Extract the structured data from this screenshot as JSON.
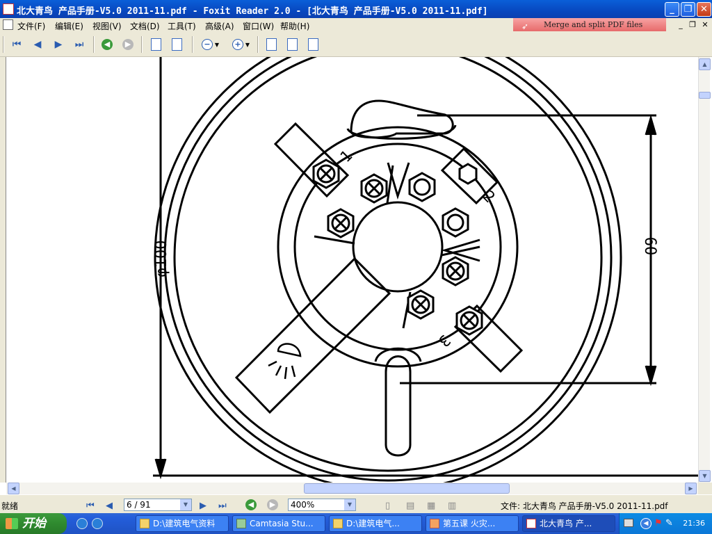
{
  "window": {
    "title": "北大青鸟 产品手册-V5.0 2011-11.pdf - Foxit Reader 2.0 - [北大青鸟 产品手册-V5.0 2011-11.pdf]"
  },
  "menu": {
    "items": [
      {
        "label": "文件(F)"
      },
      {
        "label": "编辑(E)"
      },
      {
        "label": "视图(V)"
      },
      {
        "label": "文档(D)"
      },
      {
        "label": "工具(T)"
      },
      {
        "label": "高级(A)"
      },
      {
        "label": "窗口(W)"
      },
      {
        "label": "帮助(H)"
      }
    ]
  },
  "ad_banner": {
    "label": "Merge and split PDF files"
  },
  "drawing": {
    "diameter_label": "φ100",
    "dimension_label": "60",
    "terminal_labels": [
      "1",
      "2",
      "3"
    ]
  },
  "status": {
    "ready": "就绪",
    "page": "6 / 91",
    "zoom": "400%",
    "file": "文件: 北大青鸟 产品手册-V5.0 2011-11.pdf"
  },
  "taskbar": {
    "start": "开始",
    "tasks": [
      {
        "label": "D:\\建筑电气资料"
      },
      {
        "label": "Camtasia Stu..."
      },
      {
        "label": "D:\\建筑电气..."
      },
      {
        "label": "第五课 火灾..."
      },
      {
        "label": "北大青鸟 产..."
      }
    ],
    "clock": "21:36"
  }
}
